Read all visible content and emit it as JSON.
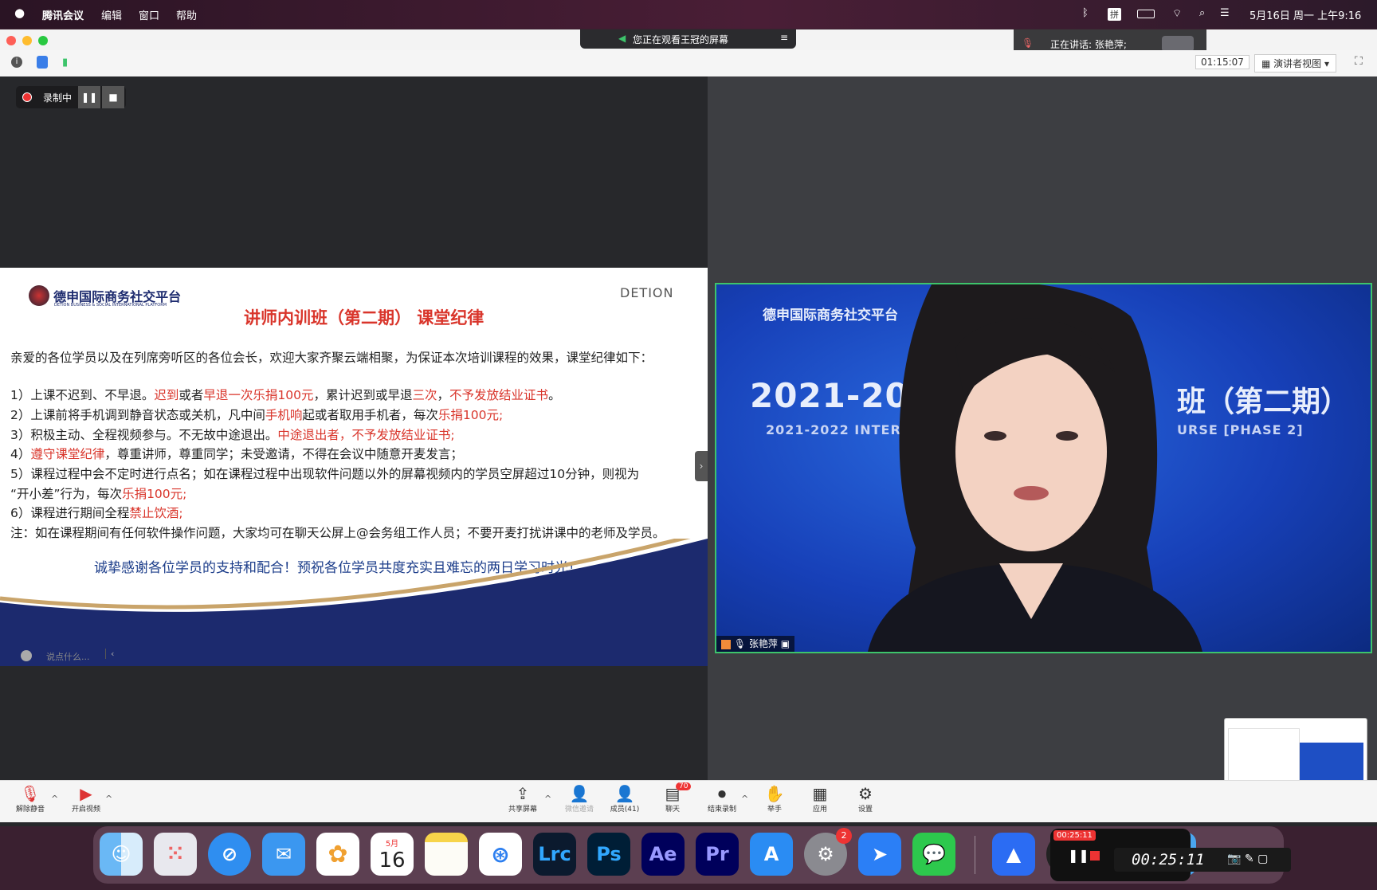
{
  "menubar": {
    "apple": "",
    "app_name": "腾讯会议",
    "items": [
      "编辑",
      "窗口",
      "帮助"
    ],
    "input_method": "拼",
    "clock": "5月16日 周一 上午9:16"
  },
  "meeting": {
    "banner": "您正在观看王冠的屏幕",
    "speaking_label": "正在讲话: 张艳萍;",
    "timer": "01:15:07",
    "view_mode": "演讲者视图",
    "recording_label": "录制中",
    "chat_placeholder": "说点什么..."
  },
  "slide": {
    "logo_cn": "德申国际商务社交平台",
    "logo_en": "DETION BUSINESS & SOCIAL INTERNATIONAL PLATFORM",
    "brand": "DETION",
    "title": "讲师内训班（第二期） 课堂纪律",
    "intro": "亲爱的各位学员以及在列席旁听区的各位会长，欢迎大家齐聚云端相聚，为保证本次培训课程的效果，课堂纪律如下：",
    "rules": [
      [
        {
          "t": "1）上课不迟到、不早退。",
          "r": false
        },
        {
          "t": "迟到",
          "r": true
        },
        {
          "t": "或者",
          "r": false
        },
        {
          "t": "早退一次乐捐100元",
          "r": true
        },
        {
          "t": "，累计迟到或早退",
          "r": false
        },
        {
          "t": "三次",
          "r": true
        },
        {
          "t": "，",
          "r": false
        },
        {
          "t": "不予发放结业证书",
          "r": true
        },
        {
          "t": "。",
          "r": false
        }
      ],
      [
        {
          "t": "2）上课前将手机调到静音状态或关机，凡中间",
          "r": false
        },
        {
          "t": "手机响",
          "r": true
        },
        {
          "t": "起或者取用手机者，每次",
          "r": false
        },
        {
          "t": "乐捐100元;",
          "r": true
        }
      ],
      [
        {
          "t": "3）积极主动、全程视频参与。不无故中途退出。",
          "r": false
        },
        {
          "t": "中途退出者，不予发放结业证书;",
          "r": true
        }
      ],
      [
        {
          "t": "4）",
          "r": false
        },
        {
          "t": "遵守课堂纪律",
          "r": true
        },
        {
          "t": "，尊重讲师，尊重同学；未受邀请，不得在会议中随意开麦发言；",
          "r": false
        }
      ],
      [
        {
          "t": "5）课程过程中会不定时进行点名；如在课程过程中出现软件问题以外的屏幕视频内的学员空屏超过10分钟，则视为",
          "r": false
        }
      ],
      [
        {
          "t": "      “开小差”行为，每次",
          "r": false
        },
        {
          "t": "乐捐100元;",
          "r": true
        }
      ],
      [
        {
          "t": "6）课程进行期间全程",
          "r": false
        },
        {
          "t": "禁止饮酒;",
          "r": true
        }
      ],
      [
        {
          "t": "注：如在课程期间有任何软件操作问题，大家均可在聊天公屏上@会务组工作人员；不要开麦打扰讲课中的老师及学员。",
          "r": false
        }
      ]
    ],
    "closing": "诚挚感谢各位学员的支持和配合！预祝各位学员共度充实且难忘的两日学习时光！"
  },
  "video": {
    "bg_logo": "德申国际商务社交平台",
    "bg_title_left": "2021-2022",
    "bg_title_right": "班（第二期）",
    "bg_sub_left": "2021-2022 INTERNAL",
    "bg_sub_right": "URSE [PHASE 2]",
    "participant": "张艳萍"
  },
  "toolbar": {
    "mute": "解除静音",
    "video": "开启视频",
    "share": "共享屏幕",
    "invite": "微信邀请",
    "members": "成员(41)",
    "chat": "聊天",
    "chat_badge": "70",
    "record": "结束录制",
    "raise_hand": "举手",
    "apps": "应用",
    "settings": "设置"
  },
  "dock": {
    "calendar_month": "5月",
    "calendar_day": "16",
    "settings_badge": "2",
    "lrc": "Lrc",
    "ps": "Ps",
    "ae": "Ae",
    "pr": "Pr"
  },
  "recorder": {
    "elapsed_small": "00:25:11",
    "elapsed": "00:25:11"
  },
  "colors": {
    "accent_red": "#d9352b",
    "video_border": "#3dc46b",
    "slide_navy": "#1c2a6e"
  }
}
